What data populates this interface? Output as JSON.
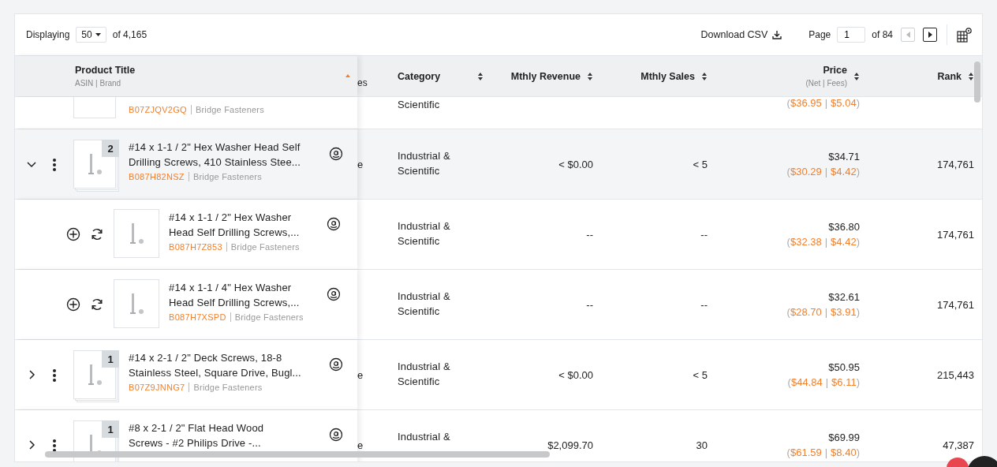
{
  "toolbar": {
    "displaying_label": "Displaying",
    "per_page": "50",
    "total": "of 4,165",
    "download": "Download CSV",
    "page_label": "Page",
    "page": "1",
    "page_total": "of 84",
    "prev_disabled": true,
    "next_disabled": false
  },
  "table": {
    "columns": [
      {
        "kind": "product",
        "label": "Product Title",
        "sublabel": "ASIN | Brand",
        "sorted": true
      },
      {
        "kind": "fragment",
        "label": "es"
      },
      {
        "kind": "left",
        "label": "Category",
        "sorted": false
      },
      {
        "kind": "right",
        "label": "Mthly Revenue",
        "sorted": false
      },
      {
        "kind": "right",
        "label": "Mthly Sales",
        "sorted": false
      },
      {
        "kind": "right",
        "label": "Price",
        "sublabel": "(Net | Fees)",
        "sorted": false
      },
      {
        "kind": "right",
        "label": "Rank",
        "sorted": false
      }
    ],
    "rows": [
      {
        "kind": "partial",
        "asin": "B07ZJQV2GQ",
        "brand": "Bridge Fasteners",
        "category": [
          "Scientific"
        ],
        "net_fees": [
          "(",
          "$36.95",
          "|",
          "$5.04",
          ")"
        ]
      },
      {
        "kind": "parent",
        "expanded": true,
        "variants": "2",
        "title_lines": [
          "#14 x 1-1 / 2\" Hex Washer Head Self",
          "Drilling Screws, 410 Stainless Stee..."
        ],
        "asin": "B087H82NSZ",
        "brand": "Bridge Fasteners",
        "fragment": "e",
        "category": [
          "Industrial &",
          "Scientific"
        ],
        "revenue": "< $0.00",
        "sales": "< 5",
        "price": "$34.71",
        "net_fees": [
          "(",
          "$30.29",
          "|",
          "$4.42",
          ")"
        ],
        "rank": "174,761"
      },
      {
        "kind": "variant",
        "title_lines": [
          "#14 x 1-1 / 2\" Hex Washer",
          "Head Self Drilling Screws,..."
        ],
        "asin": "B087H7Z853",
        "brand": "Bridge Fasteners",
        "category": [
          "Industrial &",
          "Scientific"
        ],
        "revenue": "--",
        "sales": "--",
        "price": "$36.80",
        "net_fees": [
          "(",
          "$32.38",
          "|",
          "$4.42",
          ")"
        ],
        "rank": "174,761"
      },
      {
        "kind": "variant",
        "title_lines": [
          "#14 x 1-1 / 4\" Hex Washer",
          "Head Self Drilling Screws,..."
        ],
        "asin": "B087H7XSPD",
        "brand": "Bridge Fasteners",
        "category": [
          "Industrial &",
          "Scientific"
        ],
        "revenue": "--",
        "sales": "--",
        "price": "$32.61",
        "net_fees": [
          "(",
          "$28.70",
          "|",
          "$3.91",
          ")"
        ],
        "rank": "174,761"
      },
      {
        "kind": "parent",
        "expanded": false,
        "variants": "1",
        "title_lines": [
          "#14 x 2-1 / 2\" Deck Screws, 18-8",
          "Stainless Steel, Square Drive, Bugl..."
        ],
        "asin": "B07Z9JNNG7",
        "brand": "Bridge Fasteners",
        "fragment": "e",
        "category": [
          "Industrial &",
          "Scientific"
        ],
        "revenue": "< $0.00",
        "sales": "< 5",
        "price": "$50.95",
        "net_fees": [
          "(",
          "$44.84",
          "|",
          "$6.11",
          ")"
        ],
        "rank": "215,443"
      },
      {
        "kind": "parent",
        "expanded": false,
        "variants": "1",
        "title_lines": [
          "#8 x 2-1 / 2\" Flat Head Wood",
          "Screws - #2 Philips Drive -..."
        ],
        "fragment": "e",
        "category": [
          "Industrial &"
        ],
        "revenue": "$2,099.70",
        "sales": "30",
        "price": "$69.99",
        "net_fees": [
          "(",
          "$61.59",
          "|",
          "$8.40",
          ")"
        ],
        "rank": "47,387"
      }
    ]
  }
}
